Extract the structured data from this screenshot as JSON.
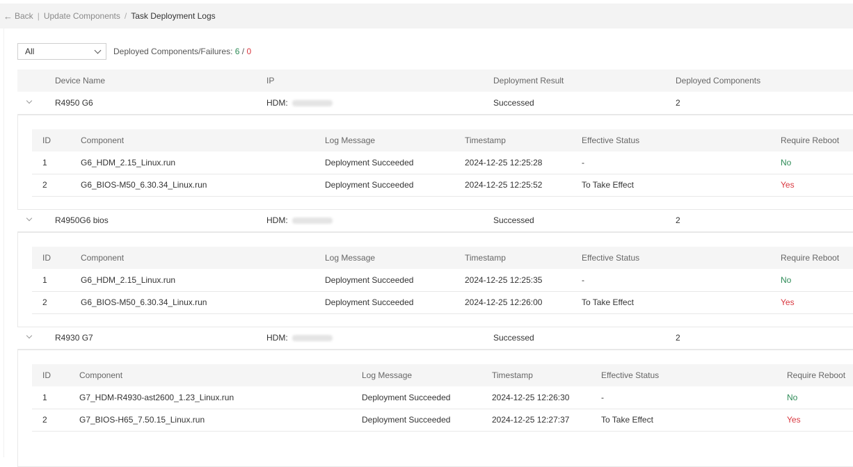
{
  "breadcrumb": {
    "back": "Back",
    "parent": "Update Components",
    "current": "Task Deployment Logs"
  },
  "filter": {
    "selected": "All",
    "summary_label": "Deployed Components/Failures:",
    "deployed": "6",
    "slash": " / ",
    "failures": "0"
  },
  "columns": {
    "device": "Device Name",
    "ip": "IP",
    "result": "Deployment Result",
    "components": "Deployed Components"
  },
  "sub_columns": {
    "id": "ID",
    "component": "Component",
    "log": "Log Message",
    "timestamp": "Timestamp",
    "status": "Effective Status",
    "reboot": "Require Reboot"
  },
  "colors": {
    "success": "#2e8b57",
    "failure": "#d9363e"
  },
  "devices": [
    {
      "name": "R4950 G6",
      "ip_prefix": "HDM:",
      "result": "Successed",
      "count": "2",
      "rows": [
        {
          "id": "1",
          "component": "G6_HDM_2.15_Linux.run",
          "log": "Deployment Succeeded",
          "timestamp": "2024-12-25 12:25:28",
          "status": "-",
          "reboot": "No"
        },
        {
          "id": "2",
          "component": "G6_BIOS-M50_6.30.34_Linux.run",
          "log": "Deployment Succeeded",
          "timestamp": "2024-12-25 12:25:52",
          "status": "To Take Effect",
          "reboot": "Yes"
        }
      ]
    },
    {
      "name": "R4950G6 bios",
      "ip_prefix": "HDM:",
      "result": "Successed",
      "count": "2",
      "rows": [
        {
          "id": "1",
          "component": "G6_HDM_2.15_Linux.run",
          "log": "Deployment Succeeded",
          "timestamp": "2024-12-25 12:25:35",
          "status": "-",
          "reboot": "No"
        },
        {
          "id": "2",
          "component": "G6_BIOS-M50_6.30.34_Linux.run",
          "log": "Deployment Succeeded",
          "timestamp": "2024-12-25 12:26:00",
          "status": "To Take Effect",
          "reboot": "Yes"
        }
      ]
    },
    {
      "name": "R4930 G7",
      "ip_prefix": "HDM:",
      "result": "Successed",
      "count": "2",
      "rows": [
        {
          "id": "1",
          "component": "G7_HDM-R4930-ast2600_1.23_Linux.run",
          "log": "Deployment Succeeded",
          "timestamp": "2024-12-25 12:26:30",
          "status": "-",
          "reboot": "No"
        },
        {
          "id": "2",
          "component": "G7_BIOS-H65_7.50.15_Linux.run",
          "log": "Deployment Succeeded",
          "timestamp": "2024-12-25 12:27:37",
          "status": "To Take Effect",
          "reboot": "Yes"
        }
      ]
    }
  ]
}
